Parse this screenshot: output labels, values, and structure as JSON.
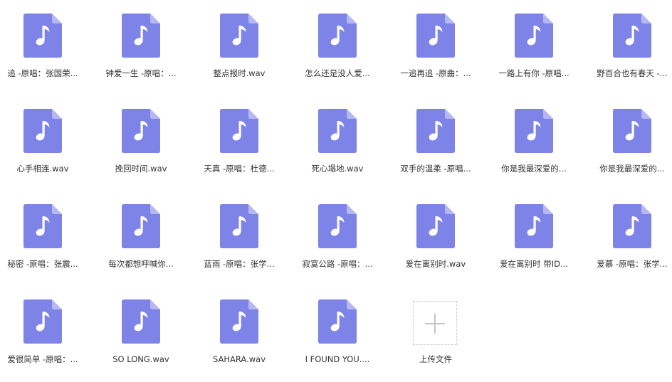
{
  "icon_colors": {
    "file_body": "#7e83e8",
    "file_fold": "#b5b8f2",
    "note": "#ffffff"
  },
  "files": [
    {
      "name": "追 -原唱：张国荣...",
      "icon": "music-file-icon"
    },
    {
      "name": "钟爱一生 -原唱：...",
      "icon": "music-file-icon"
    },
    {
      "name": "整点报时.wav",
      "icon": "music-file-icon"
    },
    {
      "name": "怎么还是没人爱...",
      "icon": "music-file-icon"
    },
    {
      "name": "一追再追 -原曲：...",
      "icon": "music-file-icon"
    },
    {
      "name": "一路上有你 -原唱...",
      "icon": "music-file-icon"
    },
    {
      "name": "野百合也有春天 -...",
      "icon": "music-file-icon"
    },
    {
      "name": "心手相连.wav",
      "icon": "music-file-icon"
    },
    {
      "name": "挽回时间.wav",
      "icon": "music-file-icon"
    },
    {
      "name": "天真 -原唱：杜德...",
      "icon": "music-file-icon"
    },
    {
      "name": "死心塌地.wav",
      "icon": "music-file-icon"
    },
    {
      "name": "双手的温柔 -原唱...",
      "icon": "music-file-icon"
    },
    {
      "name": "你是我最深爱的...",
      "icon": "music-file-icon"
    },
    {
      "name": "你是我最深爱的...",
      "icon": "music-file-icon"
    },
    {
      "name": "秘密 -原唱：张震...",
      "icon": "music-file-icon"
    },
    {
      "name": "每次都想呼喊你...",
      "icon": "music-file-icon"
    },
    {
      "name": "蓝雨 -原唱：张学...",
      "icon": "music-file-icon"
    },
    {
      "name": "寂寞公路 -原唱：...",
      "icon": "music-file-icon"
    },
    {
      "name": "爱在离别时.wav",
      "icon": "music-file-icon"
    },
    {
      "name": "爱在离别时 带ID...",
      "icon": "music-file-icon"
    },
    {
      "name": "爱慕 -原唱：张学...",
      "icon": "music-file-icon"
    },
    {
      "name": "爱很简单 -原唱：...",
      "icon": "music-file-icon"
    },
    {
      "name": "SO LONG.wav",
      "icon": "music-file-icon"
    },
    {
      "name": "SAHARA.wav",
      "icon": "music-file-icon"
    },
    {
      "name": "I FOUND YOU....",
      "icon": "music-file-icon"
    }
  ],
  "upload": {
    "label": "上传文件",
    "icon": "plus-icon"
  }
}
